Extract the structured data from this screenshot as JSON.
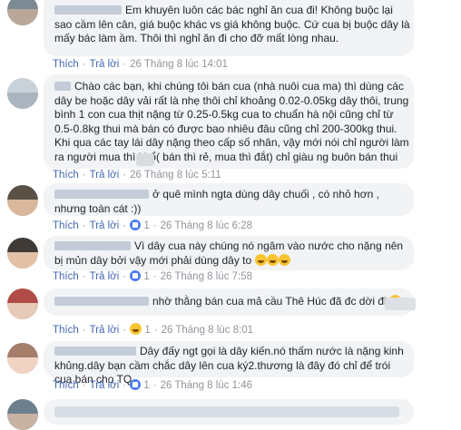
{
  "comments": [
    {
      "text": "Em khuyên luôn các bác nghỉ ăn cua đi! Không buộc lại sao cầm lên cân, giá buộc khác vs giá không buộc. Cứ cua bị buộc dây là mấy bác làm ầm. Thôi thì nghỉ ăn đi cho đỡ mất lòng nhau.",
      "like": "Thích",
      "reply": "Trả lời",
      "time": "26 Tháng 8 lúc 14:01"
    },
    {
      "text": "Chào các bạn, khi chúng tôi bán cua (nhà nuôi cua ma) thì dùng các dây be hoặc dây vải rất là nhẹ thôi chỉ khoảng 0.02-0.05kg dây thôi, trung bình 1 con cua thịt nặng từ 0.25-0.5kg cua to chuẩn hà nội cũng chỉ từ 0.5-0.8kg thui mà bán có được bao nhiêu đâu cũng chỉ 200-300kg thui. Khi qua các tay lái dây nặng theo cấp số nhân, vậy mới nói chỉ người làm ra người mua thì khổ( bán thì rẻ, mua thì đắt) chỉ giàu ng buôn bán thui",
      "like": "Thích",
      "reply": "Trả lời",
      "time": "26 Tháng 8 lúc 5:11"
    },
    {
      "text": "ở quê mình ngta dùng dây chuối , có nhỏ hơn , nhưng toàn cát :))",
      "like": "Thích",
      "reply": "Trả lời",
      "count": "1",
      "time": "26 Tháng 8 lúc 6:28"
    },
    {
      "text": "Vì dây cua này chúng nó ngâm vào nước cho nặng nên bị mủn dây bởi vậy mới phải dùng dây to",
      "like": "Thích",
      "reply": "Trả lời",
      "count": "1",
      "time": "26 Tháng 8 lúc 7:58"
    },
    {
      "text": "nhờ thằng bán cua mả cầu Thê Húc đã đc dời đi",
      "like": "Thích",
      "reply": "Trả lời",
      "count": "1",
      "time": "26 Tháng 8 lúc 8:01"
    },
    {
      "text": "Dây đấy ngt gọi là dây kiến.nó thấm nước là nặng kinh khủng.dây bạn cầm chắc dây lên cua ký2.thương là đây đó chỉ để trói cua bán cho TQ",
      "like": "Thích",
      "reply": "Trả lời",
      "count": "1",
      "time": "26 Tháng 8 lúc 1:46"
    }
  ],
  "colors": {
    "link": "#4267b2",
    "meta": "#90949c",
    "bubble": "#f2f3f5",
    "text": "#1d2129"
  },
  "icons": [
    "like-badge-icon",
    "laughing-emoji-icon",
    "avatar"
  ]
}
